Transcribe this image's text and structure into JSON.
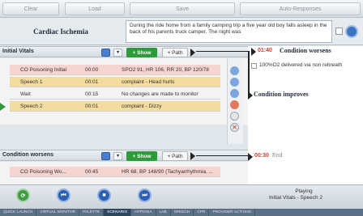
{
  "toolbar": {
    "clear": "Clear",
    "load": "Load",
    "save": "Save",
    "auto": "Auto-Responses"
  },
  "scenario": {
    "title": "Cardiac Ischemia",
    "description": "During the ride home from a family camping trip a five year old boy falls asleep in the back of his parents truck camper. The night was"
  },
  "state1": {
    "name": "Initial Vitals",
    "show_label": "+ Show",
    "path_label": "+ Path",
    "rows": [
      {
        "name": "CO Poisoning Initial",
        "time": "00:00",
        "detail": "SPO2 91, HR 106, RR 20, BP 120/78",
        "color": "#f7d4cf"
      },
      {
        "name": "Speech 1",
        "time": "00:01",
        "detail": "complaint - Head hurts",
        "color": "#f4dc9e"
      },
      {
        "name": "Wait",
        "time": "00:15",
        "detail": "No changes are made to monitor",
        "color": "#f3f3f3"
      },
      {
        "name": "Speech 2",
        "time": "00:01",
        "detail": "complaint - Dizzy",
        "color": "#f4dc9e"
      }
    ]
  },
  "state2": {
    "name": "Condition worsens",
    "show_label": "+ Show",
    "path_label": "+ Path",
    "rows": [
      {
        "name": "CO Poisoning Wo...",
        "time": "00:45",
        "detail": "HR 68, BP 148/90 (Tachyarrhythmia, ...",
        "color": "#f7d4cf"
      }
    ]
  },
  "branches": {
    "worse_timer": "01:40",
    "worse_label": "Condition worsens",
    "item": "100%O2 delivered via non rebreath",
    "improves_label": "Condition improves",
    "end_timer": "00:30",
    "end_label": "End"
  },
  "status": {
    "playing": "Playing",
    "current": "Initial Vitals - Speech 2"
  },
  "tabs": [
    "QUICK LAUNCH",
    "VIRTUAL MONITOR",
    "PALETTE",
    "SCENARIO",
    "HYPOXIA",
    "LAB",
    "SPEECH",
    "CPR",
    "PROVIDER ACTIONS"
  ],
  "selected_tab": "SCENARIO"
}
